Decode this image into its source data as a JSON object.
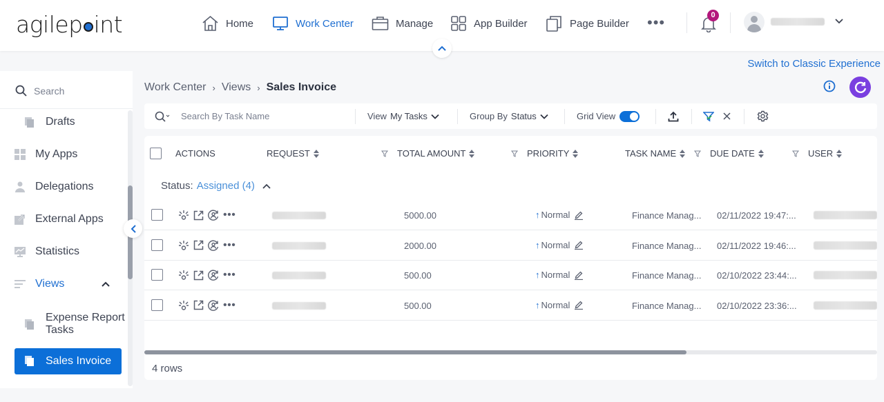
{
  "header": {
    "logo": {
      "pre": "agilep",
      "post": "int"
    },
    "nav": [
      {
        "id": "home",
        "label": "Home",
        "icon": "home-icon",
        "active": false
      },
      {
        "id": "work-center",
        "label": "Work Center",
        "icon": "monitor-icon",
        "active": true
      },
      {
        "id": "manage",
        "label": "Manage",
        "icon": "briefcase-icon",
        "active": false
      },
      {
        "id": "app-builder",
        "label": "App Builder",
        "icon": "grid-icon",
        "active": false
      },
      {
        "id": "page-builder",
        "label": "Page Builder",
        "icon": "copy-icon",
        "active": false
      }
    ],
    "more_label": "•••",
    "notifications_count": "0",
    "colors": {
      "accent": "#1f6fd1",
      "badge": "#b3177c",
      "refresh": "#7a3fe0"
    }
  },
  "switch_classic_label": "Switch to Classic Experience",
  "sidebar": {
    "search_label": "Search",
    "items": [
      {
        "label": "Drafts",
        "icon": "drafts-icon",
        "sub": true
      },
      {
        "label": "My Apps",
        "icon": "apps-icon",
        "sub": false
      },
      {
        "label": "Delegations",
        "icon": "person-icon",
        "sub": false
      },
      {
        "label": "External Apps",
        "icon": "external-apps-icon",
        "sub": false
      },
      {
        "label": "Statistics",
        "icon": "statistics-icon",
        "sub": false
      },
      {
        "label": "Views",
        "icon": "views-icon",
        "sub": false,
        "expanded": true
      },
      {
        "label": "Expense Report Tasks",
        "icon": "view-page-icon",
        "sub": true
      },
      {
        "label": "Sales Invoice",
        "icon": "view-page-icon",
        "sub": true,
        "selected": true
      }
    ]
  },
  "breadcrumb": {
    "items": [
      "Work Center",
      "Views"
    ],
    "current": "Sales Invoice",
    "separator": "›"
  },
  "toolbar": {
    "search_placeholder": "Search By Task Name",
    "view_label": "View",
    "view_value": "My Tasks",
    "group_label": "Group By",
    "group_value": "Status",
    "grid_view_label": "Grid View",
    "grid_view_on": true
  },
  "grid": {
    "columns": [
      "ACTIONS",
      "REQUEST",
      "TOTAL AMOUNT",
      "PRIORITY",
      "TASK NAME",
      "DUE DATE",
      "USER"
    ],
    "group": {
      "prefix": "Status:",
      "value": "Assigned (4)"
    },
    "rows": [
      {
        "total_amount": "5000.00",
        "priority": "Normal",
        "task_name": "Finance Manag...",
        "due_date": "02/11/2022 19:47:..."
      },
      {
        "total_amount": "2000.00",
        "priority": "Normal",
        "task_name": "Finance Manag...",
        "due_date": "02/11/2022 19:46:..."
      },
      {
        "total_amount": "500.00",
        "priority": "Normal",
        "task_name": "Finance Manag...",
        "due_date": "02/10/2022 23:44:..."
      },
      {
        "total_amount": "500.00",
        "priority": "Normal",
        "task_name": "Finance Manag...",
        "due_date": "02/10/2022 23:36:..."
      }
    ],
    "row_count_label": "4 rows",
    "horizontal_scroll_fraction": 0.74
  }
}
